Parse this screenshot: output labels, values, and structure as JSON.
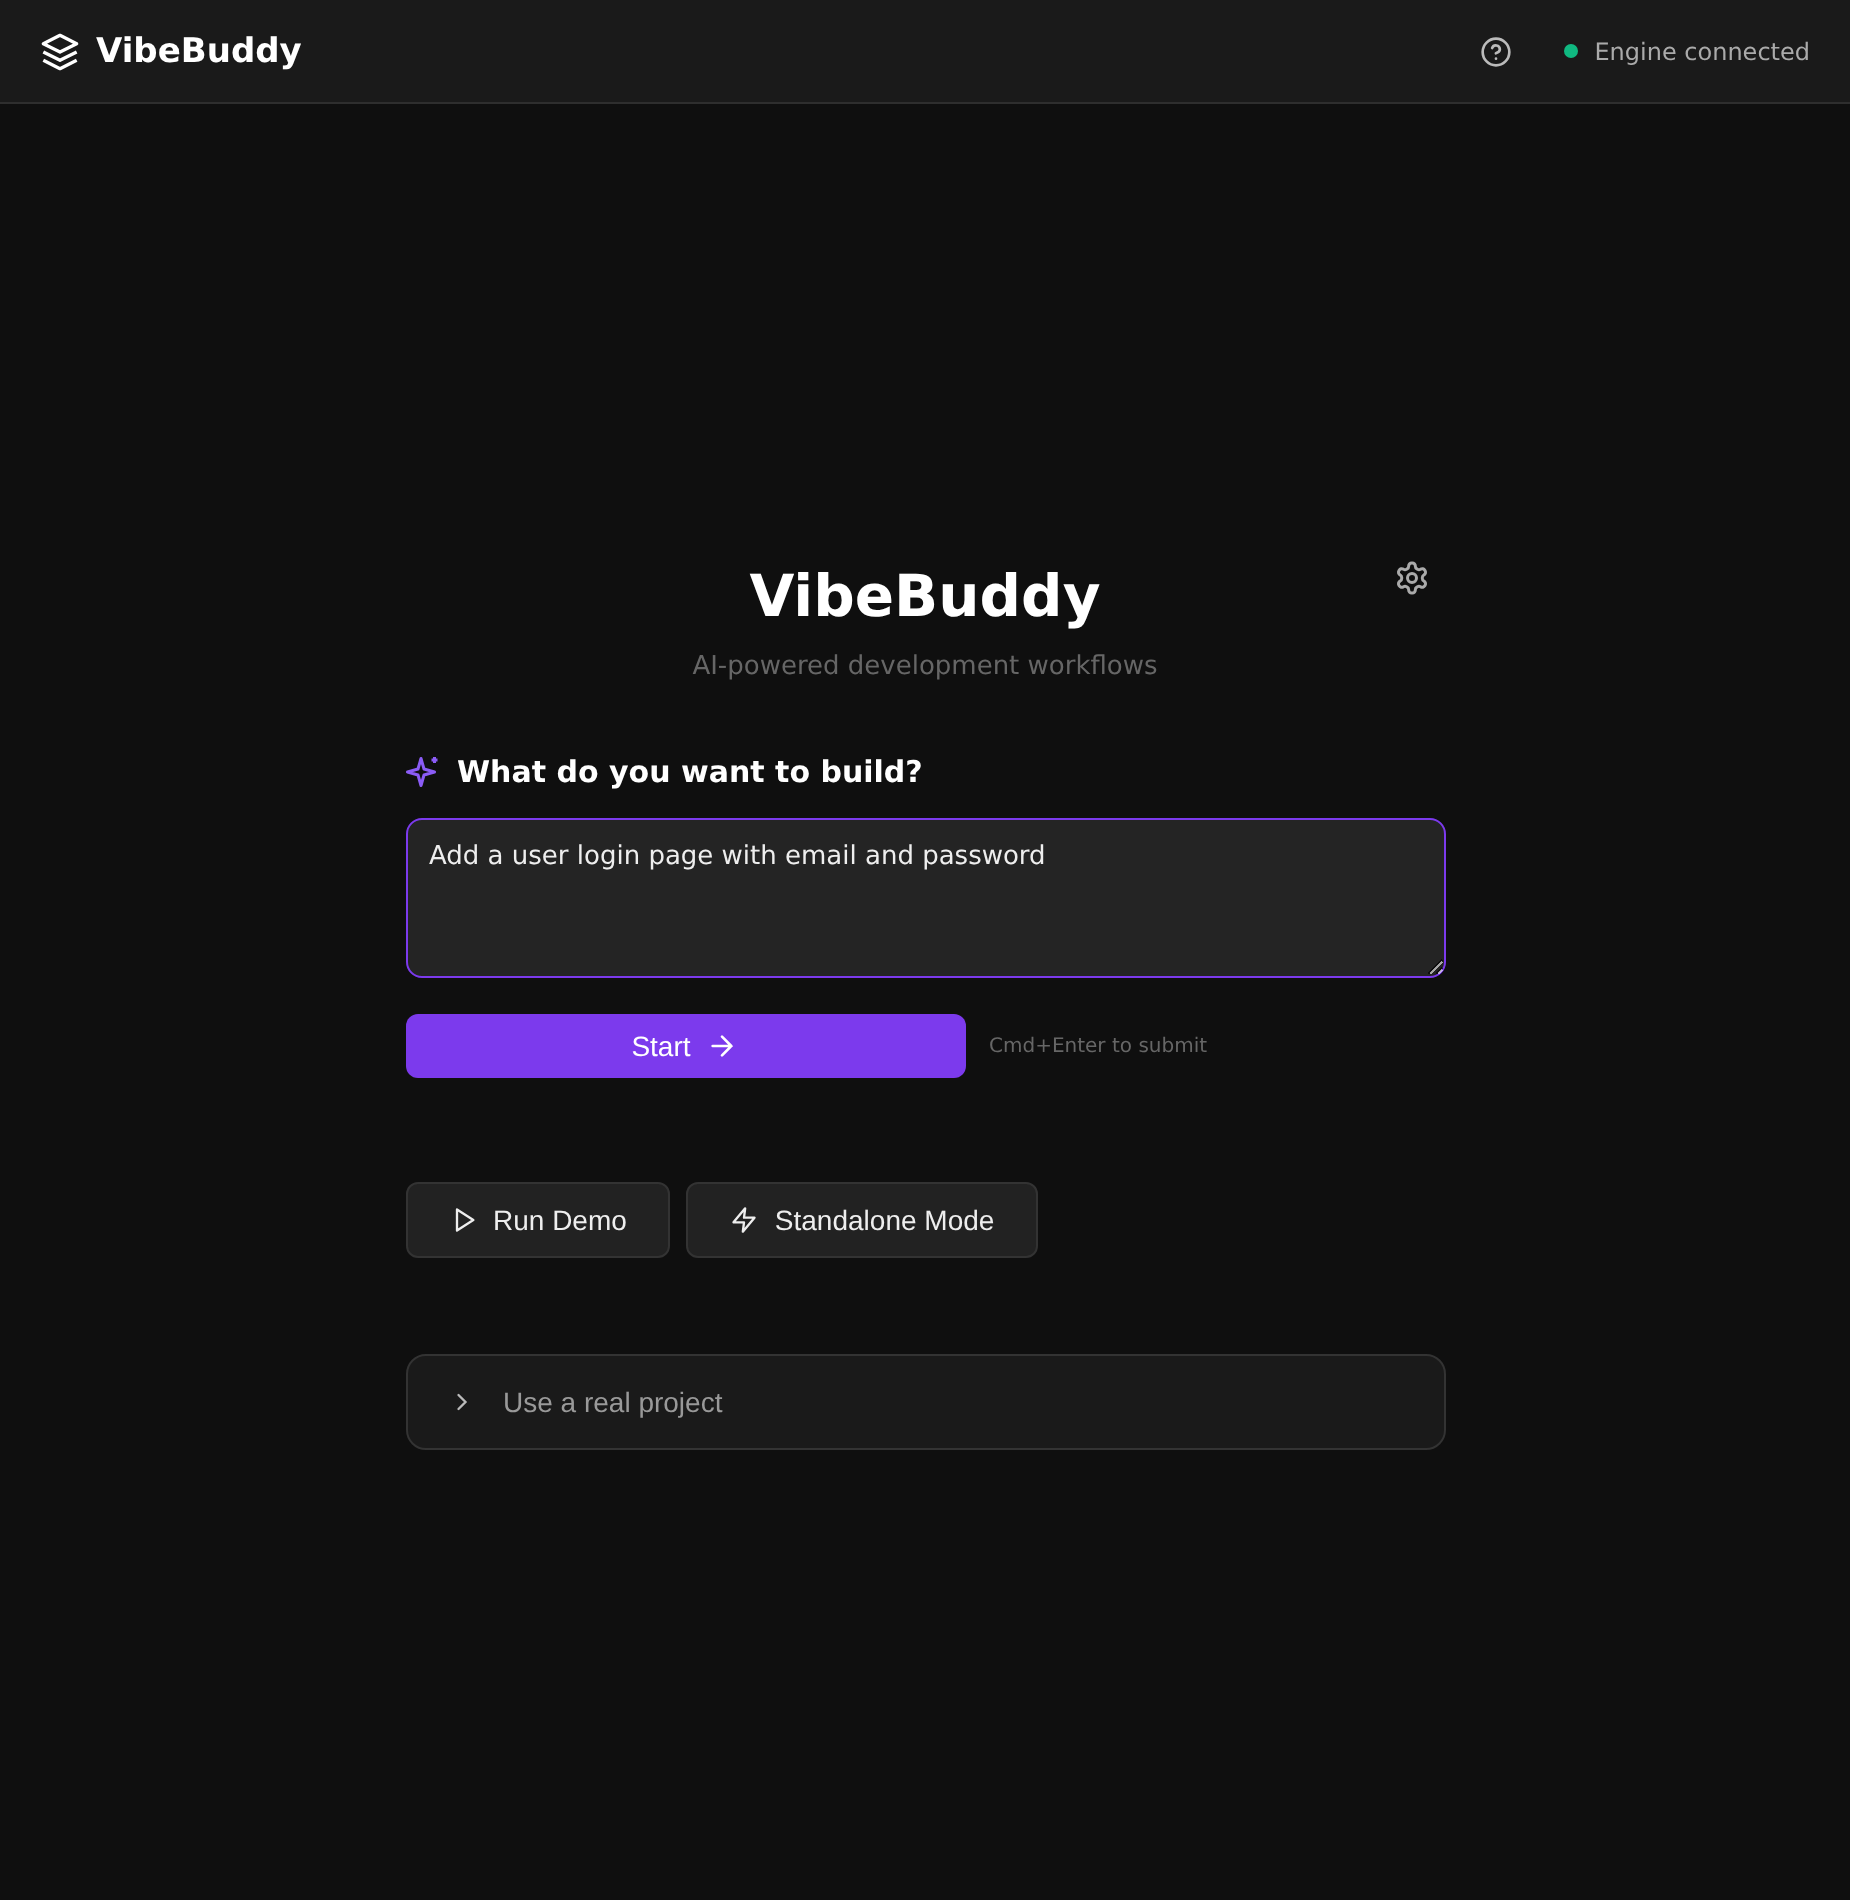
{
  "header": {
    "logo": "VibeBuddy",
    "status": {
      "label": "Engine connected",
      "connected": true
    }
  },
  "hero": {
    "title": "VibeBuddy",
    "subtitle": "AI-powered development workflows"
  },
  "prompt": {
    "heading": "What do you want to build?",
    "value": "Add a user login page with email and password",
    "focused": true
  },
  "submit": {
    "label": "Start",
    "hint": "Cmd+Enter to submit"
  },
  "actions": [
    {
      "label": "Run Demo",
      "kind": "play"
    },
    {
      "label": "Standalone Mode",
      "kind": "bolt"
    }
  ],
  "expander": {
    "label": "Use a real project",
    "expanded": false
  }
}
